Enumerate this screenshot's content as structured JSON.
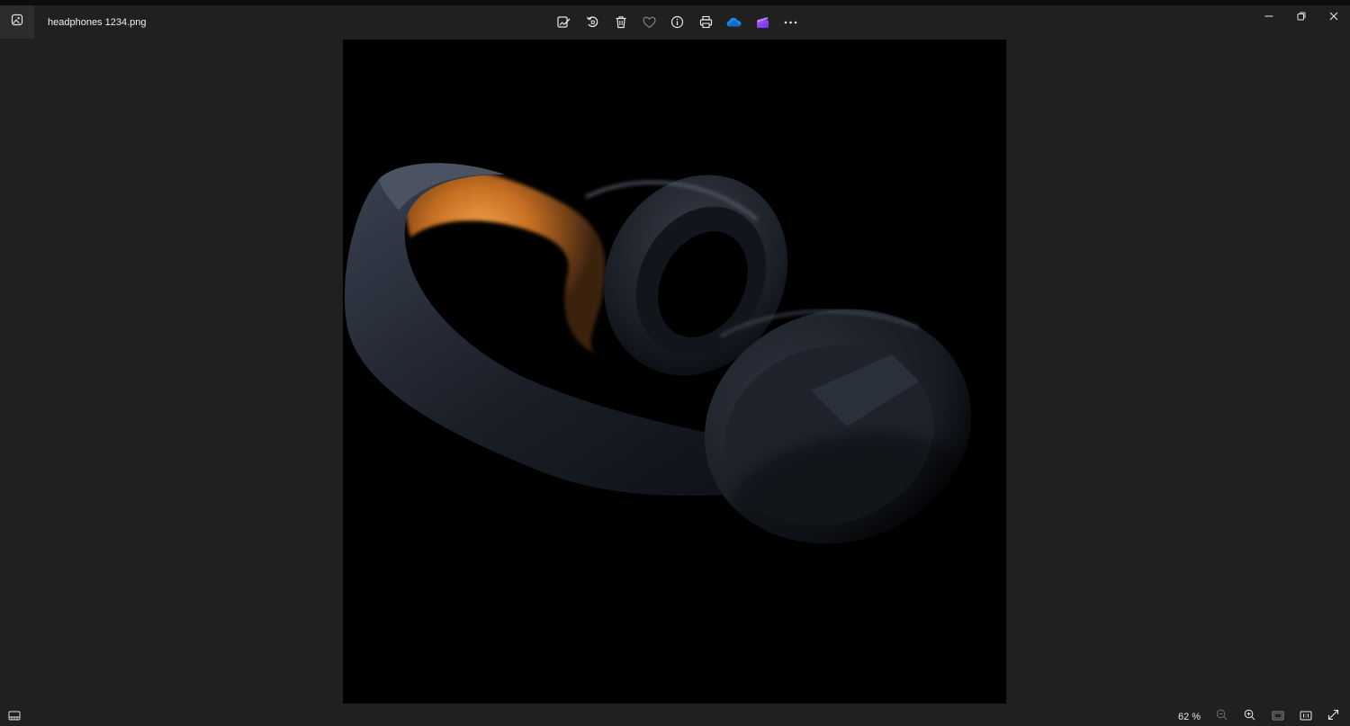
{
  "window": {
    "title": "headphones 1234.png",
    "app_icon": "photos-app-icon"
  },
  "toolbar": {
    "items": [
      {
        "name": "edit-image",
        "icon": "edit-image-icon"
      },
      {
        "name": "rotate",
        "icon": "rotate-icon"
      },
      {
        "name": "delete",
        "icon": "delete-icon"
      },
      {
        "name": "favorite",
        "icon": "heart-icon"
      },
      {
        "name": "file-info",
        "icon": "info-icon"
      },
      {
        "name": "print",
        "icon": "print-icon"
      },
      {
        "name": "onedrive",
        "icon": "onedrive-icon"
      },
      {
        "name": "clipchamp",
        "icon": "clipchamp-icon"
      },
      {
        "name": "more",
        "icon": "more-icon"
      }
    ]
  },
  "window_controls": [
    "minimize",
    "restore",
    "close"
  ],
  "status": {
    "zoom": "62 %",
    "zoom_level": 62
  },
  "colors": {
    "background": "#202020",
    "photo_background": "#000000",
    "onedrive_blue": "#1a8cf0",
    "clipchamp_purple": "#7a4df5",
    "headphone_accent": "#e58a2c"
  }
}
